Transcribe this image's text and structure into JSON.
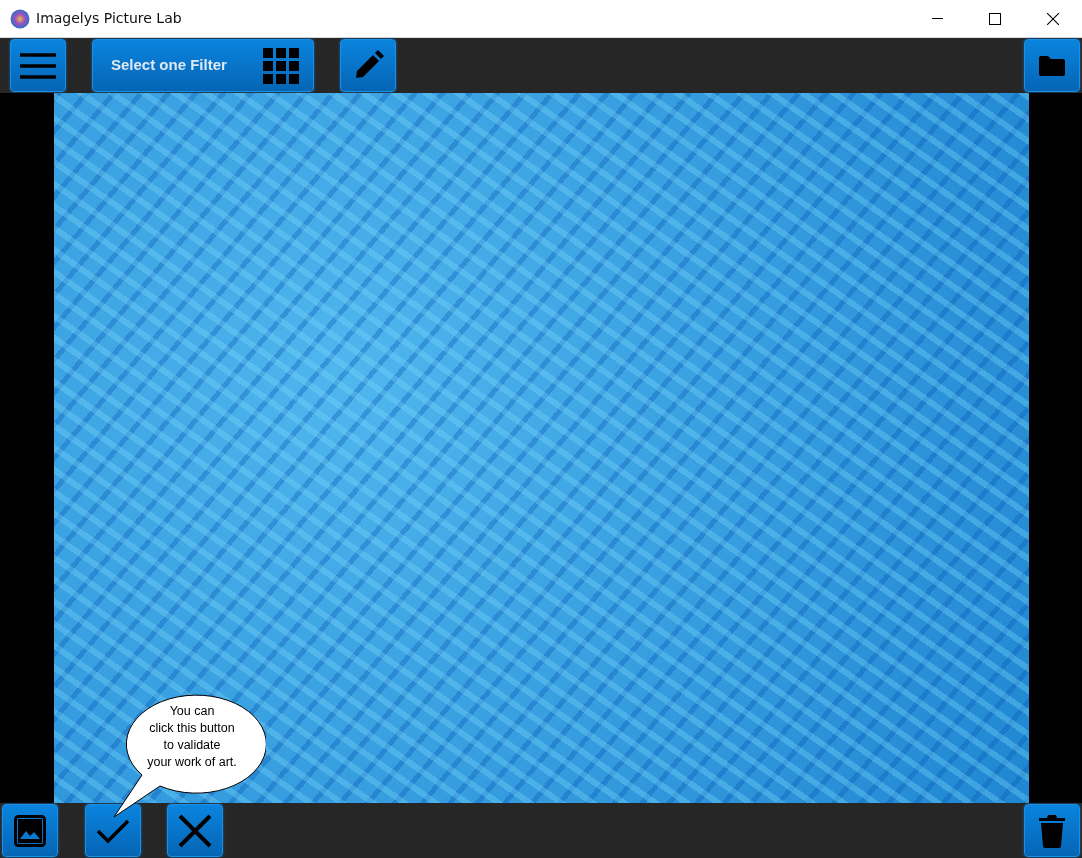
{
  "window": {
    "title": "Imagelys Picture Lab"
  },
  "toolbar": {
    "filter_button": {
      "label": "Select one Filter"
    }
  },
  "tooltip": {
    "text": "You can\nclick this button\nto validate\nyour work of art."
  }
}
